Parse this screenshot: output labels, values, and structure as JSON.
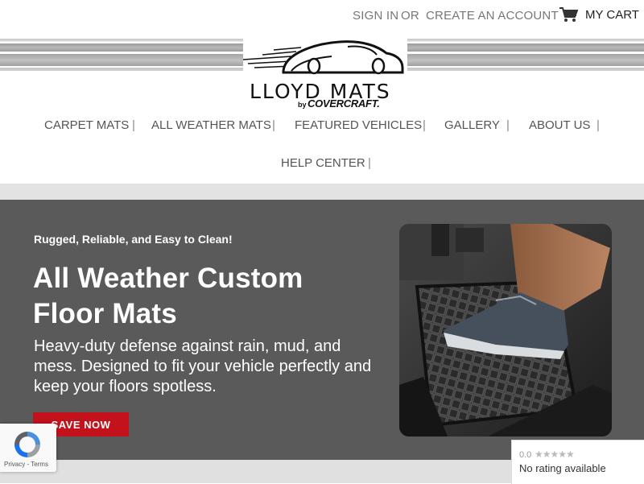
{
  "header": {
    "sign_in": "SIGN IN",
    "or": "OR",
    "create_account": "CREATE AN ACCOUNT",
    "cart": "MY CART"
  },
  "logo": {
    "name": "LLOYD MATS",
    "by": "by",
    "brand": "COVERCRAFT."
  },
  "nav": {
    "items": [
      "CARPET MATS",
      "ALL WEATHER MATS",
      "FEATURED VEHICLES",
      "GALLERY",
      "ABOUT US",
      "HELP CENTER"
    ],
    "separator": "|"
  },
  "hero": {
    "tagline": "Rugged, Reliable, and Easy to Clean!",
    "title": "All Weather Custom Floor Mats",
    "description": "Heavy-duty defense against rain, mud, and mess. Designed to fit your vehicle perfectly and keep your floors spotless.",
    "cta": "SAVE NOW"
  },
  "recaptcha": {
    "links": "Privacy - Terms"
  },
  "rating_widget": {
    "score": "0.0",
    "stars": "★★★★★",
    "text": "No rating available"
  },
  "colors": {
    "hero_bg": "#5a5a5a",
    "cta_bg": "#c4121c",
    "nav_text": "#555555"
  }
}
